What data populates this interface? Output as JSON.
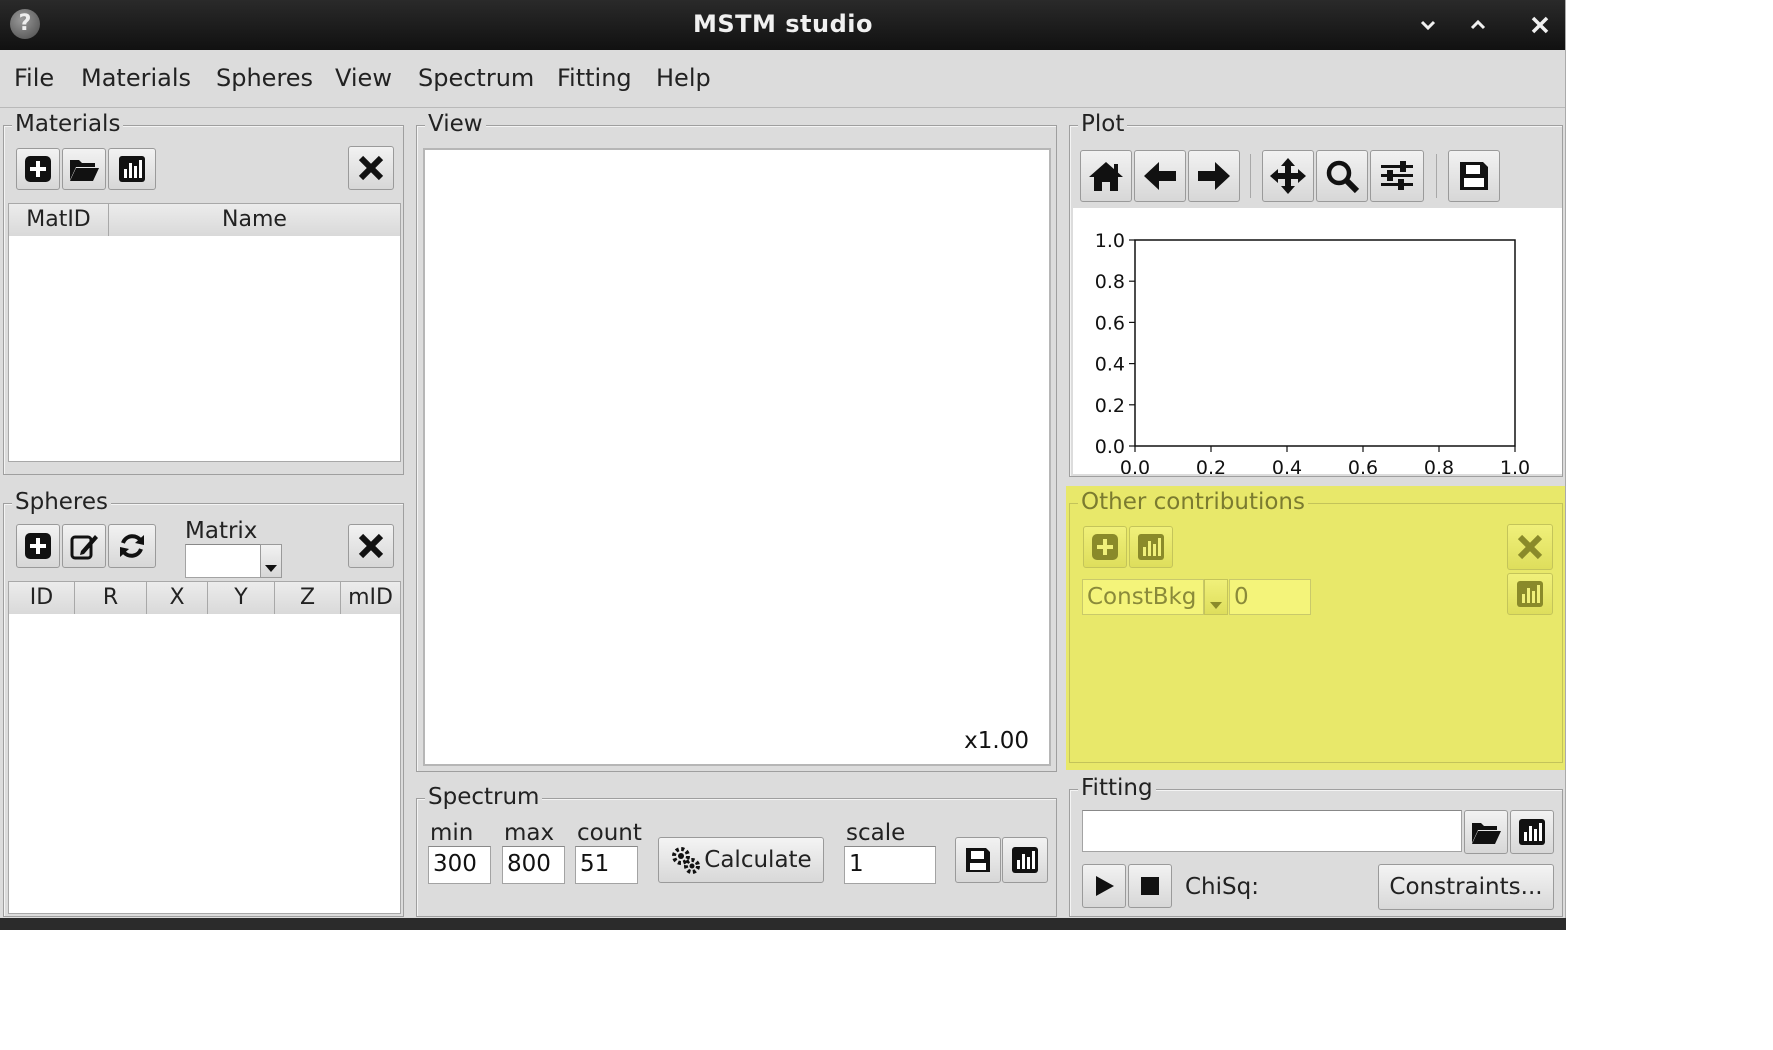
{
  "window": {
    "title": "MSTM studio"
  },
  "menu": [
    "File",
    "Materials",
    "Spheres",
    "View",
    "Spectrum",
    "Fitting",
    "Help"
  ],
  "materials": {
    "label": "Materials",
    "columns": [
      "MatID",
      "Name"
    ]
  },
  "spheres": {
    "label": "Spheres",
    "matrix_label": "Matrix",
    "matrix_value": "",
    "columns": [
      "ID",
      "R",
      "X",
      "Y",
      "Z",
      "mID"
    ]
  },
  "view": {
    "label": "View",
    "zoom": "x1.00"
  },
  "spectrum": {
    "label": "Spectrum",
    "min_label": "min",
    "max_label": "max",
    "count_label": "count",
    "scale_label": "scale",
    "min": "300",
    "max": "800",
    "count": "51",
    "scale": "1",
    "calculate": "Calculate"
  },
  "plot": {
    "label": "Plot",
    "toolbar_icons": [
      "home-icon",
      "back-arrow-icon",
      "forward-arrow-icon",
      "pan-icon",
      "zoom-icon",
      "configure-icon",
      "save-icon"
    ]
  },
  "chart_data": {
    "type": "line",
    "title": "",
    "xlabel": "",
    "ylabel": "",
    "xlim": [
      0.0,
      1.0
    ],
    "ylim": [
      0.0,
      1.0
    ],
    "xticks": [
      "0.0",
      "0.2",
      "0.4",
      "0.6",
      "0.8",
      "1.0"
    ],
    "yticks": [
      "0.0",
      "0.2",
      "0.4",
      "0.6",
      "0.8",
      "1.0"
    ],
    "series": [],
    "grid": false
  },
  "contributions": {
    "label": "Other contributions",
    "items": [
      {
        "type": "ConstBkg",
        "value": "0"
      }
    ],
    "highlight_color": "#e8e86a"
  },
  "fitting": {
    "label": "Fitting",
    "path": "",
    "chisq_label": "ChiSq:",
    "constraints": "Constraints..."
  }
}
